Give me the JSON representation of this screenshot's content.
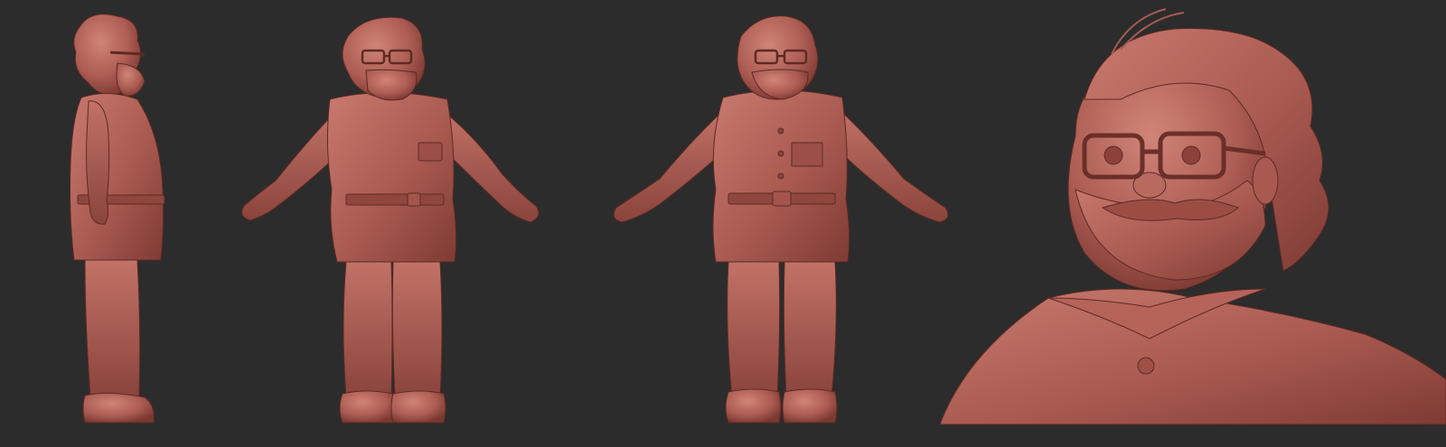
{
  "scene": {
    "background_color": "#2c2c2c",
    "clay_color": "#b8655a",
    "clay_shadow_color": "#7a3a33",
    "clay_highlight_color": "#cf8277",
    "views": [
      {
        "name": "side-view"
      },
      {
        "name": "three-quarter-view"
      },
      {
        "name": "front-view"
      },
      {
        "name": "head-closeup-view"
      }
    ]
  }
}
